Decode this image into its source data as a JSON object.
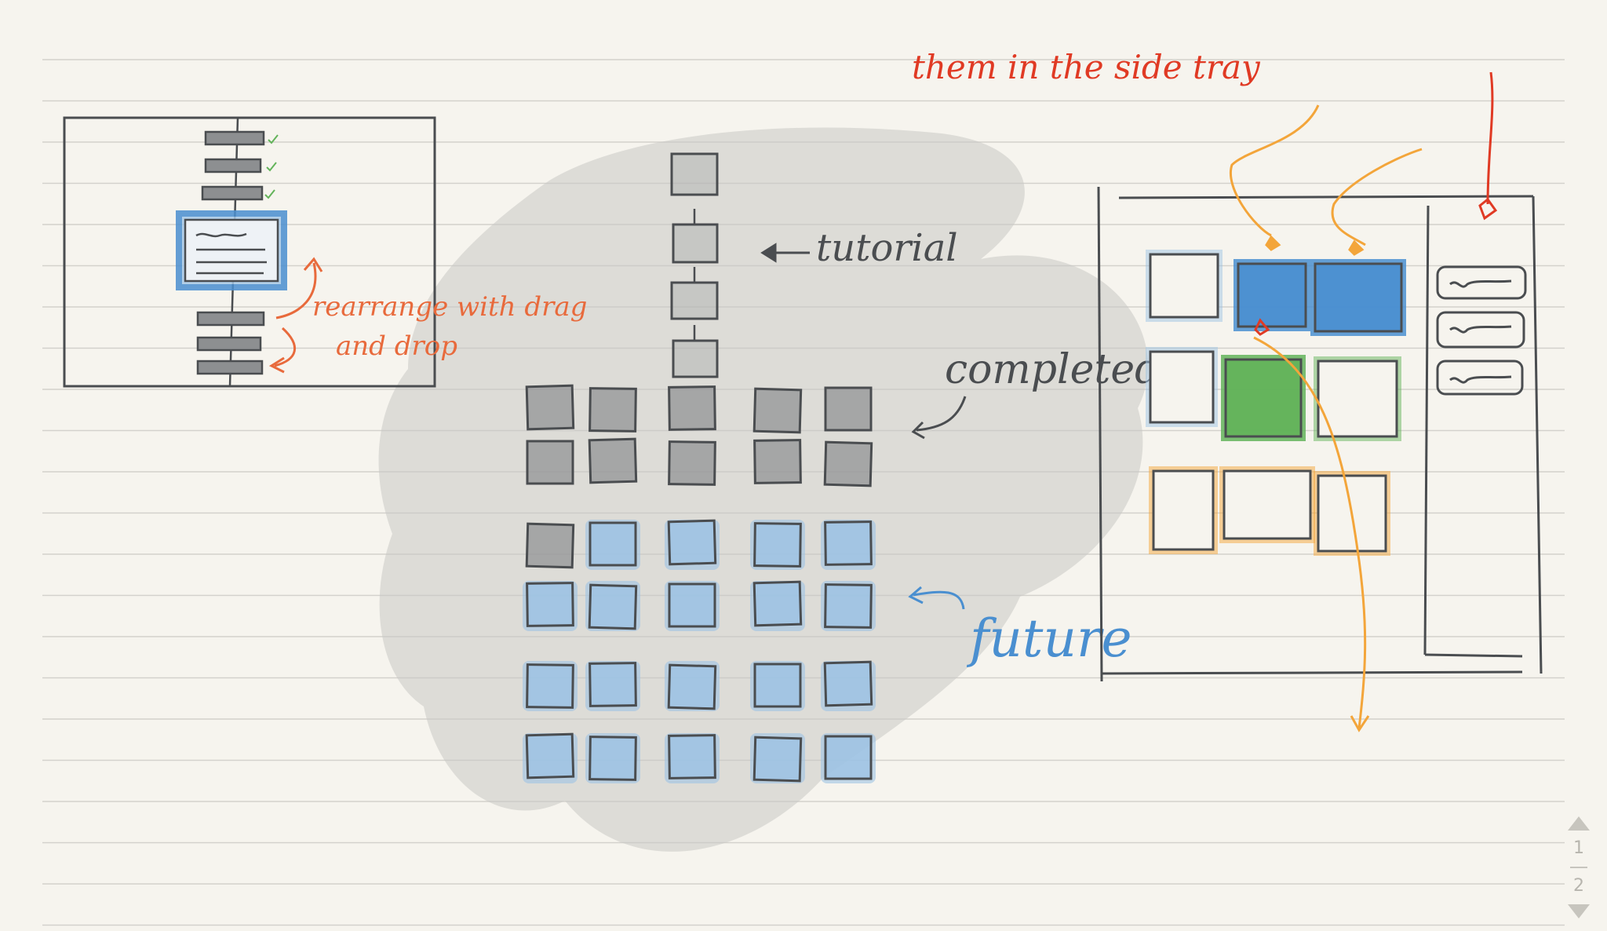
{
  "canvas": {
    "paper_color": "#f6f4ee",
    "rule_color": "#d3d1cc"
  },
  "annotations": {
    "side_tray": "them in the side tray",
    "tutorial": "tutorial",
    "completed": "completed",
    "future": "future",
    "rearrange_line1": "rearrange with drag",
    "rearrange_line2": "and drop"
  },
  "colors": {
    "ink": "#4a4d50",
    "blue": "#4a8fd0",
    "light_blue": "#9ec3e4",
    "green": "#63b35a",
    "orange": "#f3a53a",
    "red": "#e03a24",
    "annotation_orange": "#e86a3c",
    "shadow": "#c9c8c4"
  },
  "pager": {
    "current_page": "1",
    "total_pages": "2"
  }
}
